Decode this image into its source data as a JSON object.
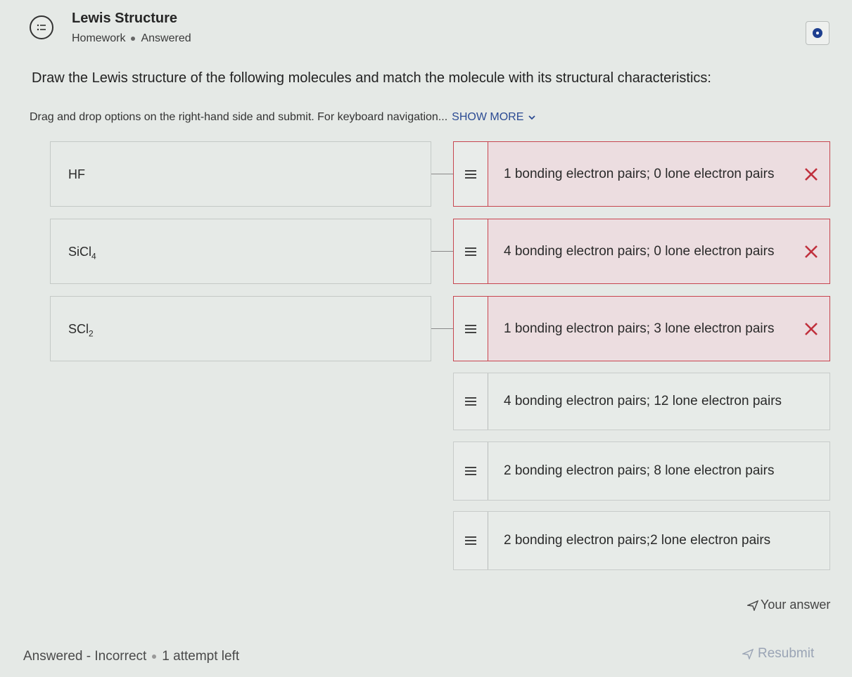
{
  "header": {
    "title": "Lewis Structure",
    "type": "Homework",
    "status": "Answered",
    "icon": "quiz-list-icon"
  },
  "question": "Draw the Lewis structure of the following molecules and match the molecule with its structural characteristics:",
  "instructions": {
    "text": "Drag and drop options on the right-hand side and submit. For keyboard navigation...",
    "show_more": "SHOW MORE"
  },
  "molecules": [
    {
      "symbol": "HF",
      "sub": ""
    },
    {
      "symbol": "SiCl",
      "sub": "4"
    },
    {
      "symbol": "SCl",
      "sub": "2"
    }
  ],
  "options": [
    {
      "label": "1 bonding electron pairs; 0 lone electron pairs",
      "state": "incorrect"
    },
    {
      "label": "4 bonding electron pairs; 0 lone electron pairs",
      "state": "incorrect"
    },
    {
      "label": "1 bonding electron pairs; 3 lone electron pairs",
      "state": "incorrect"
    },
    {
      "label": "4 bonding electron pairs; 12 lone electron pairs",
      "state": "unplaced"
    },
    {
      "label": "2 bonding electron pairs; 8 lone electron pairs",
      "state": "unplaced"
    },
    {
      "label": "2 bonding electron pairs;2 lone electron pairs",
      "state": "unplaced"
    }
  ],
  "footer": {
    "your_answer": "Your answer",
    "result": "Answered - Incorrect",
    "attempts": "1 attempt left",
    "resubmit": "Resubmit"
  },
  "colors": {
    "incorrect_border": "#c7454f",
    "incorrect_x": "#c0303d",
    "link": "#2c4b93"
  }
}
